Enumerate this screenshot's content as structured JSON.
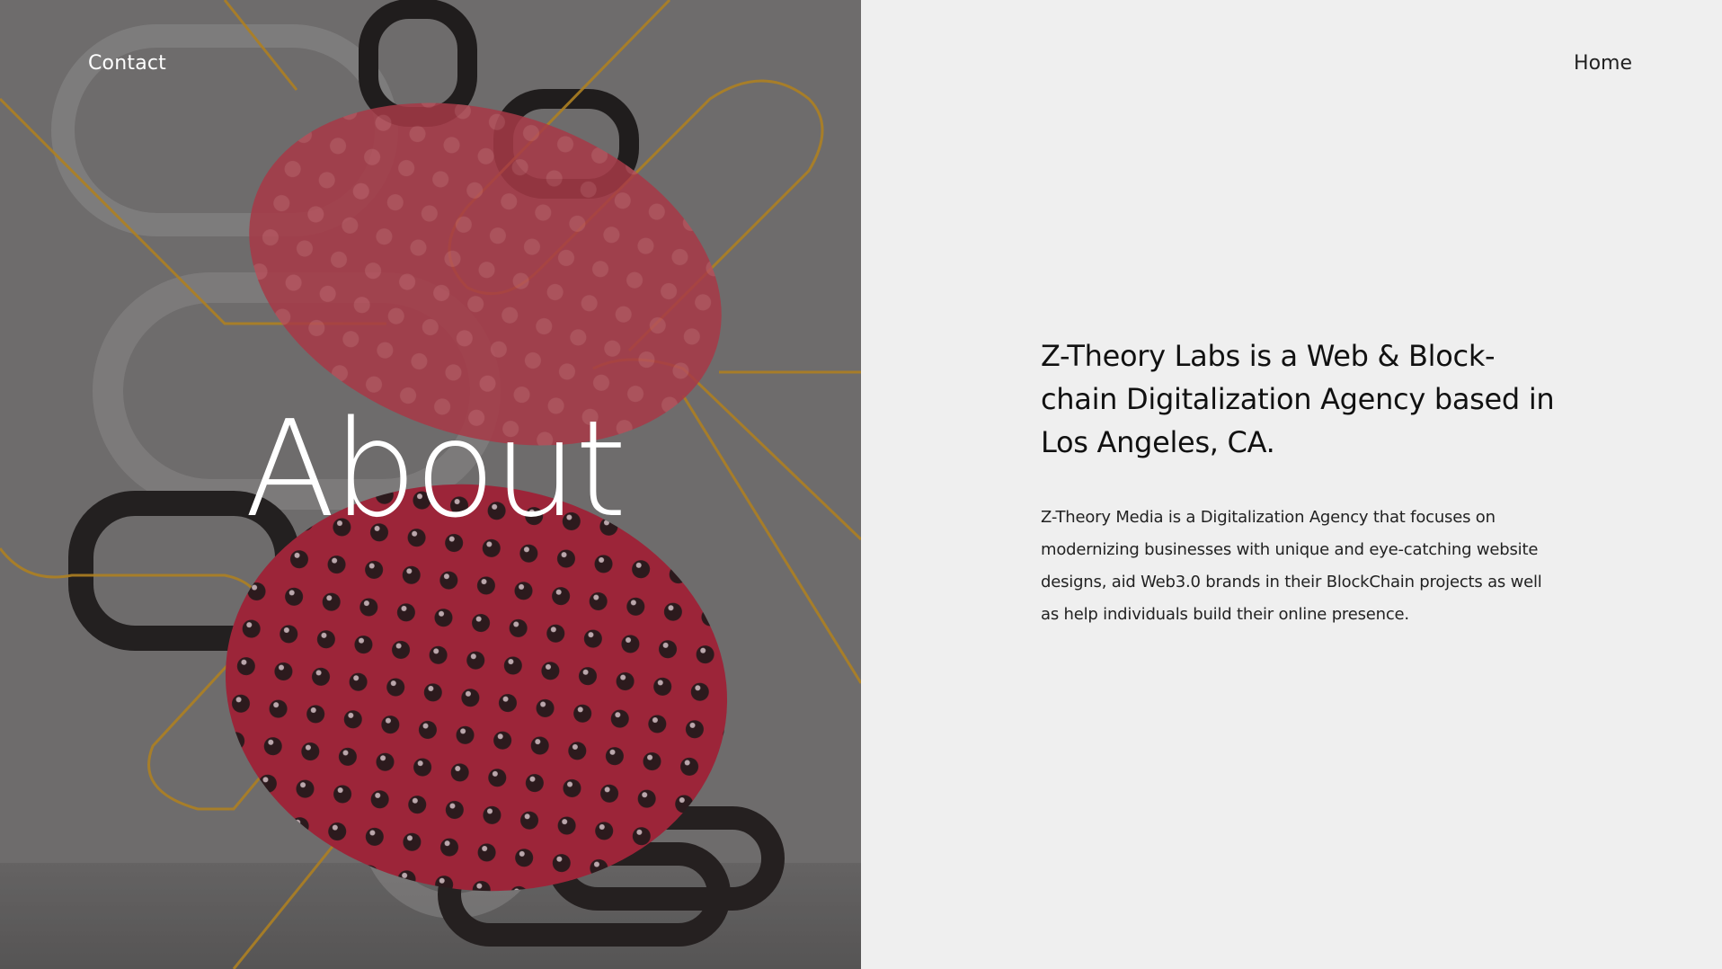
{
  "nav": {
    "contact_label": "Contact",
    "home_label": "Home"
  },
  "hero": {
    "title": "About",
    "image_alt": "3D render of glossy black and clear chain links, red dotted discs and thin golden wires"
  },
  "about": {
    "headline": "Z-Theory Labs is a Web & Block-chain Digitalization Agency based in Los Angeles, CA.",
    "description": "Z-Theory Media is a Digitalization Agency that focuses on modernizing businesses with unique and eye-catching website designs, aid Web3.0 brands in their BlockChain projects as well as help individuals build their online presence."
  },
  "colors": {
    "left_bg": "#7a7878",
    "right_bg": "#efefef",
    "accent_red": "#b3223a",
    "wire_gold": "#c8901e",
    "link_dark": "#222222"
  }
}
